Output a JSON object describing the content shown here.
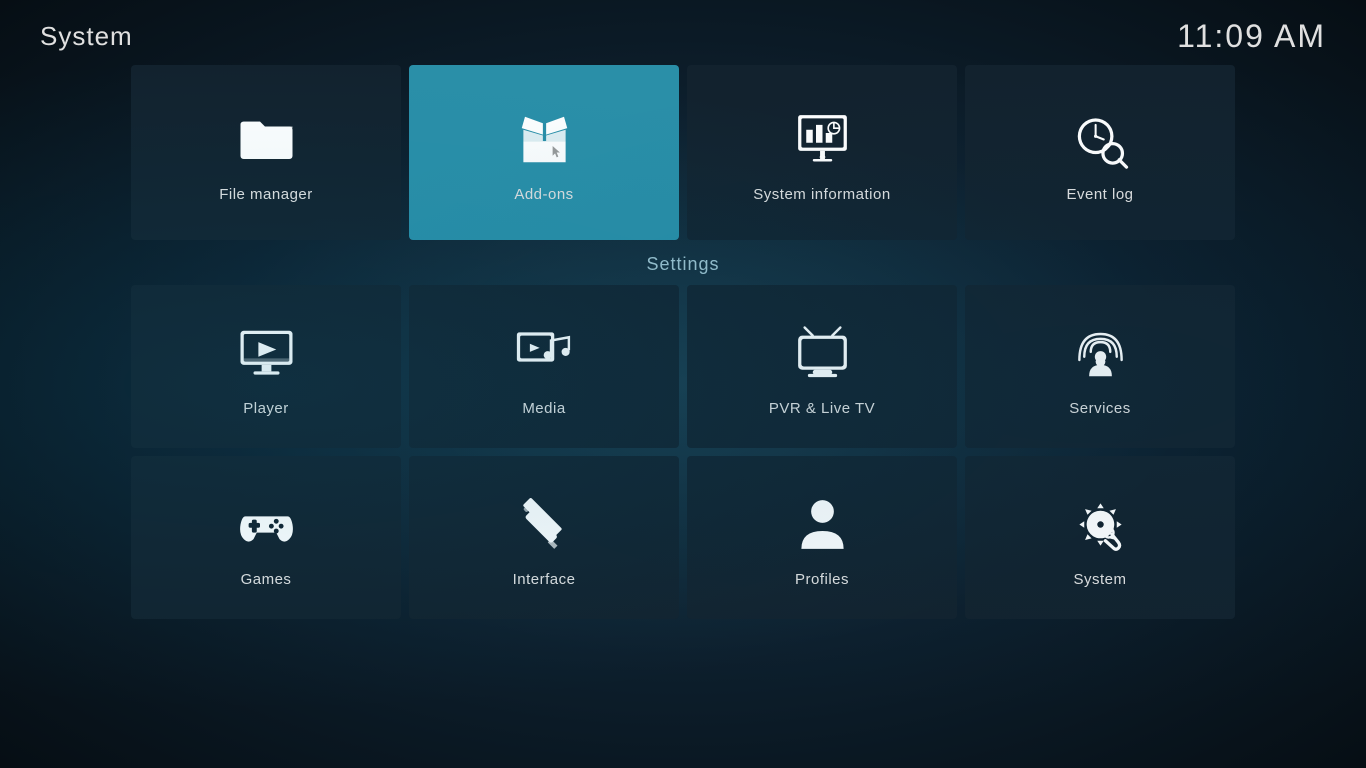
{
  "header": {
    "title": "System",
    "time": "11:09 AM"
  },
  "top_tiles": [
    {
      "id": "file-manager",
      "label": "File manager",
      "icon": "folder",
      "active": false
    },
    {
      "id": "add-ons",
      "label": "Add-ons",
      "icon": "box",
      "active": true
    },
    {
      "id": "system-information",
      "label": "System information",
      "icon": "chart",
      "active": false
    },
    {
      "id": "event-log",
      "label": "Event log",
      "icon": "clock-search",
      "active": false
    }
  ],
  "settings": {
    "label": "Settings",
    "row1": [
      {
        "id": "player",
        "label": "Player",
        "icon": "player"
      },
      {
        "id": "media",
        "label": "Media",
        "icon": "media"
      },
      {
        "id": "pvr-live-tv",
        "label": "PVR & Live TV",
        "icon": "tv"
      },
      {
        "id": "services",
        "label": "Services",
        "icon": "services"
      }
    ],
    "row2": [
      {
        "id": "games",
        "label": "Games",
        "icon": "games"
      },
      {
        "id": "interface",
        "label": "Interface",
        "icon": "interface"
      },
      {
        "id": "profiles",
        "label": "Profiles",
        "icon": "profiles"
      },
      {
        "id": "system",
        "label": "System",
        "icon": "system"
      }
    ]
  }
}
